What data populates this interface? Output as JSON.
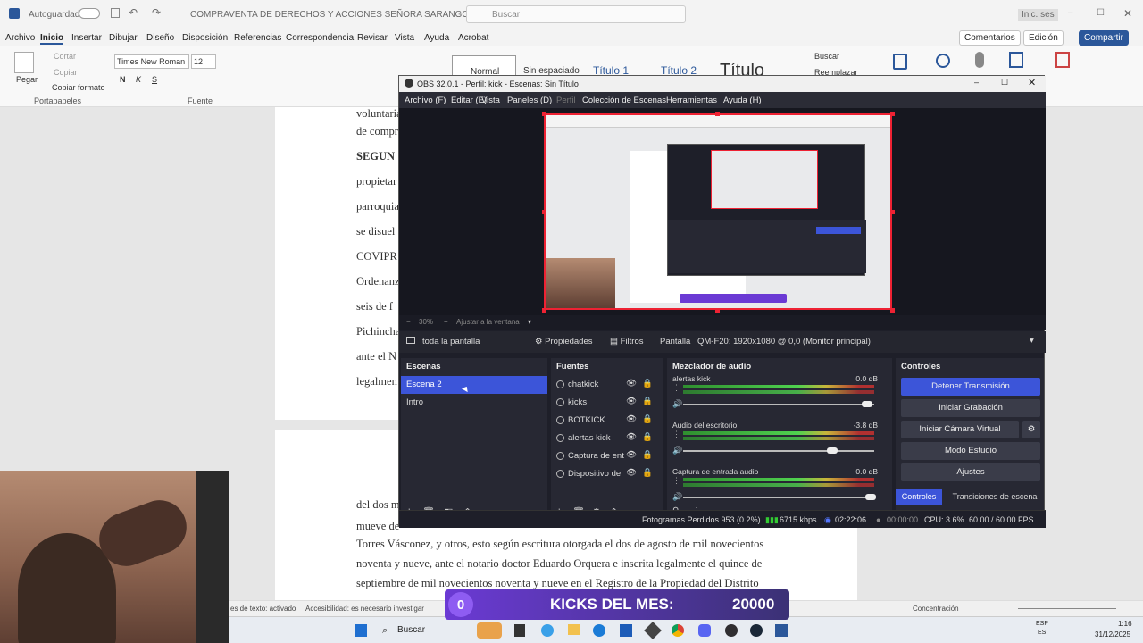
{
  "word": {
    "autosave": "Autoguardado",
    "doc_title": "COMPRAVENTA DE DERECHOS Y ACCIONES SEÑORA SARANGO VILLACIS",
    "search_placeholder": "Buscar",
    "signin": "Inic. ses",
    "menu": [
      "Archivo",
      "Inicio",
      "Insertar",
      "Dibujar",
      "Diseño",
      "Disposición",
      "Referencias",
      "Correspondencia",
      "Revisar",
      "Vista",
      "Ayuda",
      "Acrobat"
    ],
    "comments": "Comentarios",
    "editing": "Edición",
    "share": "Compartir",
    "ribbon": {
      "paste": "Pegar",
      "cut": "Cortar",
      "copy": "Copiar",
      "format_painter": "Copiar formato",
      "clipboard": "Portapapeles",
      "font_name": "Times New Roman",
      "font_size": "12",
      "font_group": "Fuente",
      "style_normal": "Normal",
      "style_nospacing": "Sin espaciado",
      "style_t1": "Título 1",
      "style_t2": "Título 2",
      "style_title": "Título",
      "find": "Buscar",
      "replace": "Reemplazar"
    },
    "page1_lines": [
      "voluntaria",
      "de compr",
      "SEGUN",
      "propietar",
      "parroquia",
      "se disuel",
      "COVIPR",
      "Ordenanz",
      "seis de f",
      "Pichincha",
      "ante el N",
      "legalmen"
    ],
    "page2_lines": [
      "del dos m",
      "mueve de",
      "Torres Vásconez, y otros, esto según escritura otorgada el dos de agosto de mil novecientos",
      "noventa y nueve, ante el notario doctor Eduardo Orquera e inscrita legalmente el quince de",
      "septiembre de mil novecientos noventa y nueve en el Registro de la Propiedad del Distrito"
    ],
    "status_text": "es de texto: activado",
    "accessibility": "Accesibilidad: es necesario investigar",
    "focus": "Concentración"
  },
  "taskbar": {
    "search": "Buscar",
    "lang1": "ESP",
    "lang2": "ES",
    "time": "1:16",
    "date": "31/12/2025"
  },
  "kicks_banner": {
    "count": "0",
    "label": "KICKS DEL MES:",
    "goal": "20000"
  },
  "obs": {
    "title": "OBS 32.0.1 - Perfil: kick - Escenas: Sin Título",
    "menu": [
      "Archivo (F)",
      "Editar (E)",
      "Vista",
      "Paneles (D)",
      "Perfil",
      "Colección de Escenas",
      "Herramientas",
      "Ayuda (H)"
    ],
    "zoom": "30%",
    "fit": "Ajustar a la ventana",
    "source_name": "toda la pantalla",
    "properties": "Propiedades",
    "filters": "Filtros",
    "display_label": "Pantalla",
    "display_value": "QM-F20: 1920x1080 @ 0,0 (Monitor principal)",
    "scenes": {
      "title": "Escenas",
      "items": [
        "Escena 2",
        "Intro"
      ]
    },
    "sources": {
      "title": "Fuentes",
      "items": [
        "chatkick",
        "kicks",
        "BOTKICK",
        "alertas kick",
        "Captura de ent",
        "Dispositivo de"
      ]
    },
    "mixer": {
      "title": "Mezclador de audio",
      "channels": [
        {
          "name": "alertas kick",
          "db": "0.0 dB",
          "volume": 0.98
        },
        {
          "name": "Audio del escritorio",
          "db": "-3.8 dB",
          "volume": 0.8
        },
        {
          "name": "Captura de entrada audio",
          "db": "0.0 dB",
          "volume": 1.0
        }
      ],
      "ticks": [
        "-60",
        "-55",
        "-50",
        "-45",
        "-40",
        "-35",
        "-30",
        "-25",
        "-20",
        "-15",
        "-10",
        "-5",
        "0"
      ]
    },
    "controls": {
      "title": "Controles",
      "stop_stream": "Detener Transmisión",
      "start_rec": "Iniciar Grabación",
      "virtual_cam": "Iniciar Cámara Virtual",
      "studio": "Modo Estudio",
      "settings": "Ajustes",
      "tab_controls": "Controles",
      "tab_transitions": "Transiciones de escena"
    },
    "status": {
      "dropped": "Fotogramas Perdidos 953 (0.2%)",
      "bitrate": "6715 kbps",
      "live_time": "02:22:06",
      "rec_time": "00:00:00",
      "cpu": "CPU: 3.6%",
      "fps": "60.00 / 60.00 FPS"
    },
    "accent": "#3c55d9"
  }
}
